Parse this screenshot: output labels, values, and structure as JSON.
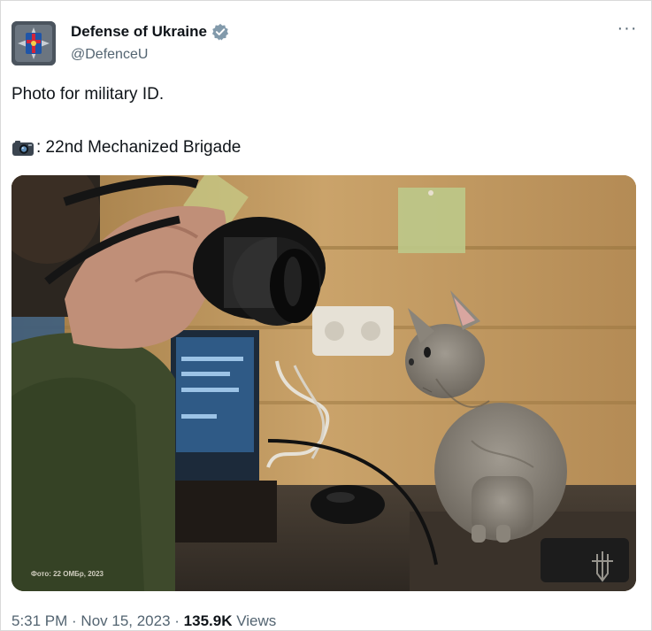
{
  "author": {
    "display_name": "Defense of Ukraine",
    "handle": "@DefenceU",
    "avatar_icon": "ministry-emblem-icon",
    "verified_icon": "verified-badge-icon",
    "verified_color": "#829aab"
  },
  "more_label": "···",
  "tweet": {
    "line1": "Photo for military ID.",
    "line2_icon": "camera-icon",
    "line2": ": 22nd Mechanized Brigade"
  },
  "media": {
    "description_icon": "photo-cat-icon",
    "watermark_text": "Фото: 22 ОМБр, 2023",
    "corner_logo_icon": "trident-icon"
  },
  "meta": {
    "time": "5:31 PM",
    "separator": " · ",
    "date": "Nov 15, 2023",
    "views_count": "135.9K",
    "views_label": " Views"
  }
}
